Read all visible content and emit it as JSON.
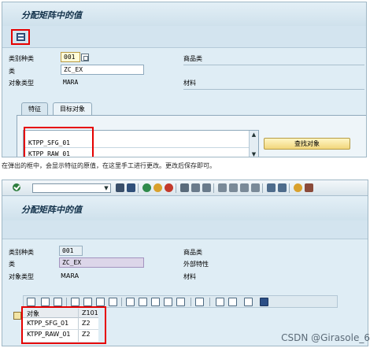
{
  "screen1": {
    "title": "分配矩阵中的值",
    "fields": {
      "class_type_label": "类别种类",
      "class_type_value": "001",
      "class_label": "类",
      "class_value": "ZC_EX",
      "class_desc": "商品类",
      "object_type_label": "对象类型",
      "object_type_value": "MARA",
      "object_type_desc": "材料"
    },
    "tabs": [
      "特征",
      "目标对象"
    ],
    "list_rows": [
      "KTPP_SFG_01",
      "KTPP_RAW_01"
    ],
    "find_button": "查找对象"
  },
  "caption": "在弹出的框中，会显示特征的原值，在这里手工进行更改。更改后保存即可。",
  "screen2": {
    "title": "分配矩阵中的值",
    "fields": {
      "class_type_label": "类别种类",
      "class_type_value": "001",
      "class_type_desc": "商品类",
      "class_label": "类",
      "class_value": "ZC_EX",
      "class_desc": "外部特性",
      "object_type_label": "对象类型",
      "object_type_value": "MARA",
      "object_type_desc": "材料"
    },
    "grid": {
      "headers": [
        "对象",
        "Z101"
      ],
      "rows": [
        [
          "KTPP_SFG_01",
          "Z2"
        ],
        [
          "KTPP_RAW_01",
          "Z2"
        ]
      ]
    }
  },
  "watermark": "CSDN @Girasole_6",
  "colors": {
    "background": "#dfedf5",
    "highlight_red": "#e60000",
    "button_yellow": "#f2d67b"
  }
}
